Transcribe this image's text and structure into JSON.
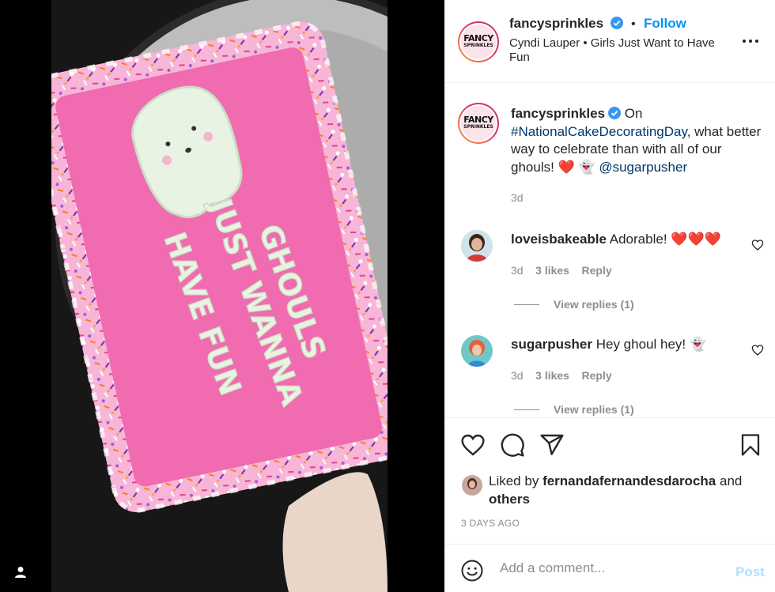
{
  "post": {
    "username": "fancysprinkles",
    "follow_label": "Follow",
    "separator": "•",
    "audio": "Cyndi Lauper • Girls Just Want to Have Fun",
    "logo_line1": "FANCY",
    "logo_line2": "SPRINKLES",
    "more_icon": "more-horizontal-icon"
  },
  "media": {
    "cake_text_lines": [
      "GHOULS",
      "JUST WANNA",
      "HAVE FUN"
    ],
    "colors": {
      "frosting": "#f06bb0",
      "trim": "#f7b6d7",
      "plate": "#cfcfcf"
    }
  },
  "caption": {
    "username": "fancysprinkles",
    "text_before": "On",
    "hashtag": "#NationalCakeDecoratingDay",
    "text_after": ", what better way to celebrate than with all of our ghouls! ",
    "emojis": "❤️ 👻",
    "mention": "@sugarpusher",
    "time": "3d"
  },
  "comments": [
    {
      "username": "loveisbakeable",
      "text": "Adorable!",
      "emojis": "❤️❤️❤️",
      "time": "3d",
      "likes": "3 likes",
      "reply": "Reply",
      "view_replies": "View replies (1)"
    },
    {
      "username": "sugarpusher",
      "text": "Hey ghoul hey!",
      "emojis": "👻",
      "time": "3d",
      "likes": "3 likes",
      "reply": "Reply",
      "view_replies": "View replies (1)"
    }
  ],
  "actions": {
    "liked_by_prefix": "Liked by",
    "liked_by_user": "fernandafernandesdarocha",
    "liked_by_and": "and",
    "liked_by_others": "others",
    "date": "3 DAYS AGO"
  },
  "add_comment": {
    "placeholder": "Add a comment...",
    "post_label": "Post"
  },
  "colors": {
    "link": "#00376b",
    "follow": "#0095f6",
    "verified": "#3897f0",
    "post_disabled": "#b2dffc"
  }
}
